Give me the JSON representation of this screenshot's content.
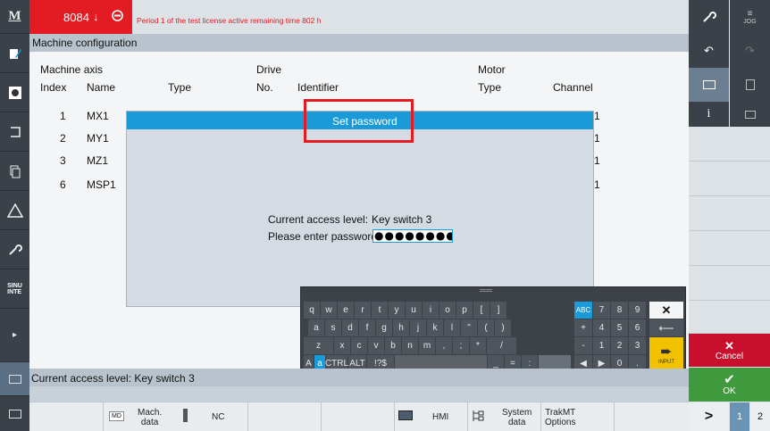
{
  "header": {
    "channel": "8084",
    "arrow": "↓",
    "message": "Period 1 of the test license active remaining time 802 h"
  },
  "title": "Machine configuration",
  "table": {
    "group_machine_axis": "Machine axis",
    "group_drive": "Drive",
    "group_motor": "Motor",
    "col_index": "Index",
    "col_name": "Name",
    "col_type": "Type",
    "col_no": "No.",
    "col_identifier": "Identifier",
    "col_motor_type": "Type",
    "col_channel": "Channel",
    "rows": [
      {
        "index": "1",
        "name": "MX1",
        "channel": "1"
      },
      {
        "index": "2",
        "name": "MY1",
        "channel": "1"
      },
      {
        "index": "3",
        "name": "MZ1",
        "channel": "1"
      },
      {
        "index": "6",
        "name": "MSP1",
        "channel": "1"
      }
    ]
  },
  "dialog": {
    "title": "Set password",
    "access_label": "Current access level:",
    "access_value": "Key switch 3",
    "password_label": "Please enter password:",
    "password_mask": "●●●●●●●●●"
  },
  "keyboard": {
    "row1": [
      "q",
      "w",
      "e",
      "r",
      "t",
      "y",
      "u",
      "i",
      "o",
      "p",
      "[",
      "]"
    ],
    "row2": [
      "a",
      "s",
      "d",
      "f",
      "g",
      "h",
      "j",
      "k",
      "l",
      "\"",
      "(",
      ")"
    ],
    "row3": [
      "z",
      "x",
      "c",
      "v",
      "b",
      "n",
      "m",
      ",",
      ";",
      "*",
      "/"
    ],
    "row4_upper": "A",
    "row4_lower": "a",
    "ctrl": "CTRL",
    "alt": "ALT",
    "sym": "!?$",
    "underscore": "_",
    "equals": "=",
    "colon": ":",
    "abc": "ABC",
    "num_row1": [
      "7",
      "8",
      "9"
    ],
    "num_row2": [
      "+",
      "4",
      "5",
      "6"
    ],
    "num_row3": [
      "-",
      "1",
      "2",
      "3"
    ],
    "zero": "0",
    "dot": ".",
    "input": "INPUT",
    "close": "✕"
  },
  "status": "Current access level: Key switch 3",
  "bottom": {
    "md_icon": "MD",
    "mach_data": "Mach.\ndata",
    "nc": "NC",
    "hmi": "HMI",
    "system_data": "System\ndata",
    "trakmt_options": "TrakMT\nOptions",
    "next": ">",
    "page1": "1",
    "page2": "2"
  },
  "right": {
    "jog": "JOG",
    "cancel": "Cancel",
    "ok": "OK"
  },
  "left": {
    "m_logo": "M",
    "sinu_logo": "SINU\nINTE"
  },
  "colors": {
    "alarm_red": "#e31b23",
    "accent_blue": "#1a9bd7",
    "cancel_red": "#c8102e",
    "ok_green": "#3e9a3c"
  }
}
